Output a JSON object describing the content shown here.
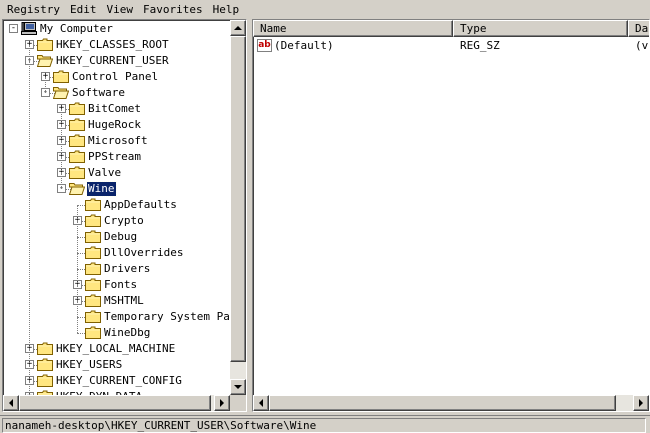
{
  "menu": {
    "items": [
      {
        "label": "Registry"
      },
      {
        "label": "Edit"
      },
      {
        "label": "View"
      },
      {
        "label": "Favorites"
      },
      {
        "label": "Help"
      }
    ]
  },
  "tree": {
    "nodes": [
      {
        "label": "My Computer",
        "level": 0,
        "expander": "-",
        "icon": "computer-icon"
      },
      {
        "label": "HKEY_CLASSES_ROOT",
        "level": 1,
        "expander": "+",
        "icon": "folder-icon"
      },
      {
        "label": "HKEY_CURRENT_USER",
        "level": 1,
        "expander": "-",
        "icon": "folder-open-icon"
      },
      {
        "label": "Control Panel",
        "level": 2,
        "expander": "+",
        "icon": "folder-icon"
      },
      {
        "label": "Software",
        "level": 2,
        "expander": "-",
        "icon": "folder-open-icon"
      },
      {
        "label": "BitComet",
        "level": 3,
        "expander": "+",
        "icon": "folder-icon"
      },
      {
        "label": "HugeRock",
        "level": 3,
        "expander": "+",
        "icon": "folder-icon"
      },
      {
        "label": "Microsoft",
        "level": 3,
        "expander": "+",
        "icon": "folder-icon"
      },
      {
        "label": "PPStream",
        "level": 3,
        "expander": "+",
        "icon": "folder-icon"
      },
      {
        "label": "Valve",
        "level": 3,
        "expander": "+",
        "icon": "folder-icon"
      },
      {
        "label": "Wine",
        "level": 3,
        "expander": "-",
        "icon": "folder-open-icon",
        "selected": true
      },
      {
        "label": "AppDefaults",
        "level": 4,
        "expander": "",
        "icon": "folder-icon"
      },
      {
        "label": "Crypto",
        "level": 4,
        "expander": "+",
        "icon": "folder-icon"
      },
      {
        "label": "Debug",
        "level": 4,
        "expander": "",
        "icon": "folder-icon"
      },
      {
        "label": "DllOverrides",
        "level": 4,
        "expander": "",
        "icon": "folder-icon"
      },
      {
        "label": "Drivers",
        "level": 4,
        "expander": "",
        "icon": "folder-icon"
      },
      {
        "label": "Fonts",
        "level": 4,
        "expander": "+",
        "icon": "folder-icon"
      },
      {
        "label": "MSHTML",
        "level": 4,
        "expander": "+",
        "icon": "folder-icon"
      },
      {
        "label": "Temporary System Param",
        "level": 4,
        "expander": "",
        "icon": "folder-icon"
      },
      {
        "label": "WineDbg",
        "level": 4,
        "expander": "",
        "icon": "folder-icon"
      },
      {
        "label": "HKEY_LOCAL_MACHINE",
        "level": 1,
        "expander": "+",
        "icon": "folder-icon"
      },
      {
        "label": "HKEY_USERS",
        "level": 1,
        "expander": "+",
        "icon": "folder-icon"
      },
      {
        "label": "HKEY_CURRENT_CONFIG",
        "level": 1,
        "expander": "+",
        "icon": "folder-icon"
      },
      {
        "label": "HKEY_DYN_DATA",
        "level": 1,
        "expander": "+",
        "icon": "folder-icon"
      }
    ]
  },
  "list": {
    "columns": [
      {
        "label": "Name"
      },
      {
        "label": "Type"
      },
      {
        "label": "Da"
      }
    ],
    "rows": [
      {
        "name": "(Default)",
        "type": "REG_SZ",
        "data": "(va",
        "icon": "string-value-icon"
      }
    ]
  },
  "status": {
    "path": "nanameh-desktop\\HKEY_CURRENT_USER\\Software\\Wine"
  },
  "colors": {
    "face": "#d4d0c8",
    "selection": "#0a246a",
    "window": "#ffffff"
  }
}
